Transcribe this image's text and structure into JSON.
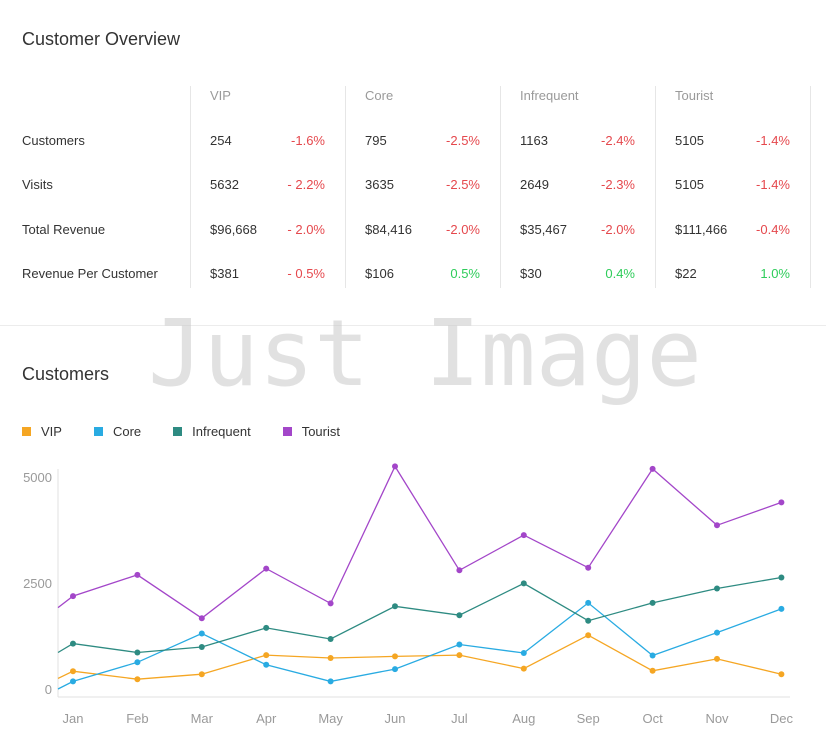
{
  "overview": {
    "title": "Customer Overview",
    "segments": [
      "VIP",
      "Core",
      "Infrequent",
      "Tourist"
    ],
    "rows": [
      {
        "label": "Customers",
        "cells": [
          {
            "value": "254",
            "change": "-1.6%",
            "trend": "neg"
          },
          {
            "value": "795",
            "change": "-2.5%",
            "trend": "neg"
          },
          {
            "value": "1163",
            "change": "-2.4%",
            "trend": "neg"
          },
          {
            "value": "5105",
            "change": "-1.4%",
            "trend": "neg"
          }
        ]
      },
      {
        "label": "Visits",
        "cells": [
          {
            "value": "5632",
            "change": "- 2.2%",
            "trend": "neg"
          },
          {
            "value": "3635",
            "change": "-2.5%",
            "trend": "neg"
          },
          {
            "value": "2649",
            "change": "-2.3%",
            "trend": "neg"
          },
          {
            "value": "5105",
            "change": "-1.4%",
            "trend": "neg"
          }
        ]
      },
      {
        "label": "Total Revenue",
        "cells": [
          {
            "value": "$96,668",
            "change": "- 2.0%",
            "trend": "neg"
          },
          {
            "value": "$84,416",
            "change": "-2.0%",
            "trend": "neg"
          },
          {
            "value": "$35,467",
            "change": "-2.0%",
            "trend": "neg"
          },
          {
            "value": "$111,466",
            "change": "-0.4%",
            "trend": "neg"
          }
        ]
      },
      {
        "label": "Revenue Per Customer",
        "cells": [
          {
            "value": "$381",
            "change": "- 0.5%",
            "trend": "neg"
          },
          {
            "value": "$106",
            "change": "0.5%",
            "trend": "pos"
          },
          {
            "value": "$30",
            "change": "0.4%",
            "trend": "pos"
          },
          {
            "value": "$22",
            "change": "1.0%",
            "trend": "pos"
          }
        ]
      }
    ]
  },
  "watermark": "Just Image",
  "colors": {
    "negative": "#e5484d",
    "positive": "#2ecc5a",
    "vip": "#f5a623",
    "core": "#29abe2",
    "infrequent": "#2e8b82",
    "tourist": "#a346c9"
  },
  "chart_data": {
    "type": "line",
    "title": "Customers",
    "categories": [
      "Jan",
      "Feb",
      "Mar",
      "Apr",
      "May",
      "Jun",
      "Jul",
      "Aug",
      "Sep",
      "Oct",
      "Nov",
      "Dec"
    ],
    "ylim": [
      0,
      5000
    ],
    "yticks": [
      0,
      2500,
      5000
    ],
    "ytick_labels": [
      "0",
      "2500",
      "5000"
    ],
    "grid": false,
    "legend": "top-left",
    "series": [
      {
        "name": "VIP",
        "color": "#f5a623",
        "start": 250,
        "values": [
          420,
          230,
          350,
          800,
          730,
          770,
          800,
          480,
          1270,
          430,
          710,
          350
        ]
      },
      {
        "name": "Core",
        "color": "#29abe2",
        "start": 0,
        "values": [
          180,
          630,
          1310,
          570,
          180,
          470,
          1050,
          850,
          2030,
          790,
          1330,
          1890
        ]
      },
      {
        "name": "Infrequent",
        "color": "#2e8b82",
        "start": 860,
        "values": [
          1070,
          860,
          990,
          1440,
          1180,
          1950,
          1740,
          2490,
          1610,
          2030,
          2370,
          2630
        ]
      },
      {
        "name": "Tourist",
        "color": "#a346c9",
        "start": 1920,
        "values": [
          2190,
          2690,
          1670,
          2840,
          2020,
          5250,
          2800,
          3630,
          2860,
          5190,
          3860,
          4400
        ]
      }
    ]
  }
}
